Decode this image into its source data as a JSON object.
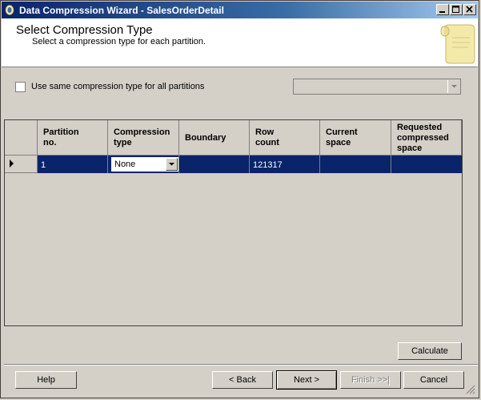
{
  "window": {
    "title": "Data Compression Wizard - SalesOrderDetail"
  },
  "header": {
    "title": "Select Compression Type",
    "subtitle": "Select a compression type for each partition."
  },
  "options": {
    "same_type_label": "Use same compression type for all partitions",
    "same_type_checked": false,
    "same_type_combo_value": ""
  },
  "grid": {
    "columns": [
      [
        "Partition",
        "no."
      ],
      [
        "Compression",
        "type"
      ],
      [
        "Boundary"
      ],
      [
        "Row",
        "count"
      ],
      [
        "Current",
        "space"
      ],
      [
        "Requested",
        "compressed",
        "space"
      ]
    ],
    "rows": [
      {
        "partition_no": "1",
        "compression_type": "None",
        "boundary": "",
        "row_count": "121317",
        "current_space": "",
        "requested_space": ""
      }
    ]
  },
  "buttons": {
    "calculate": "Calculate",
    "help": "Help",
    "back": "< Back",
    "next": "Next >",
    "finish": "Finish >>|",
    "cancel": "Cancel"
  }
}
